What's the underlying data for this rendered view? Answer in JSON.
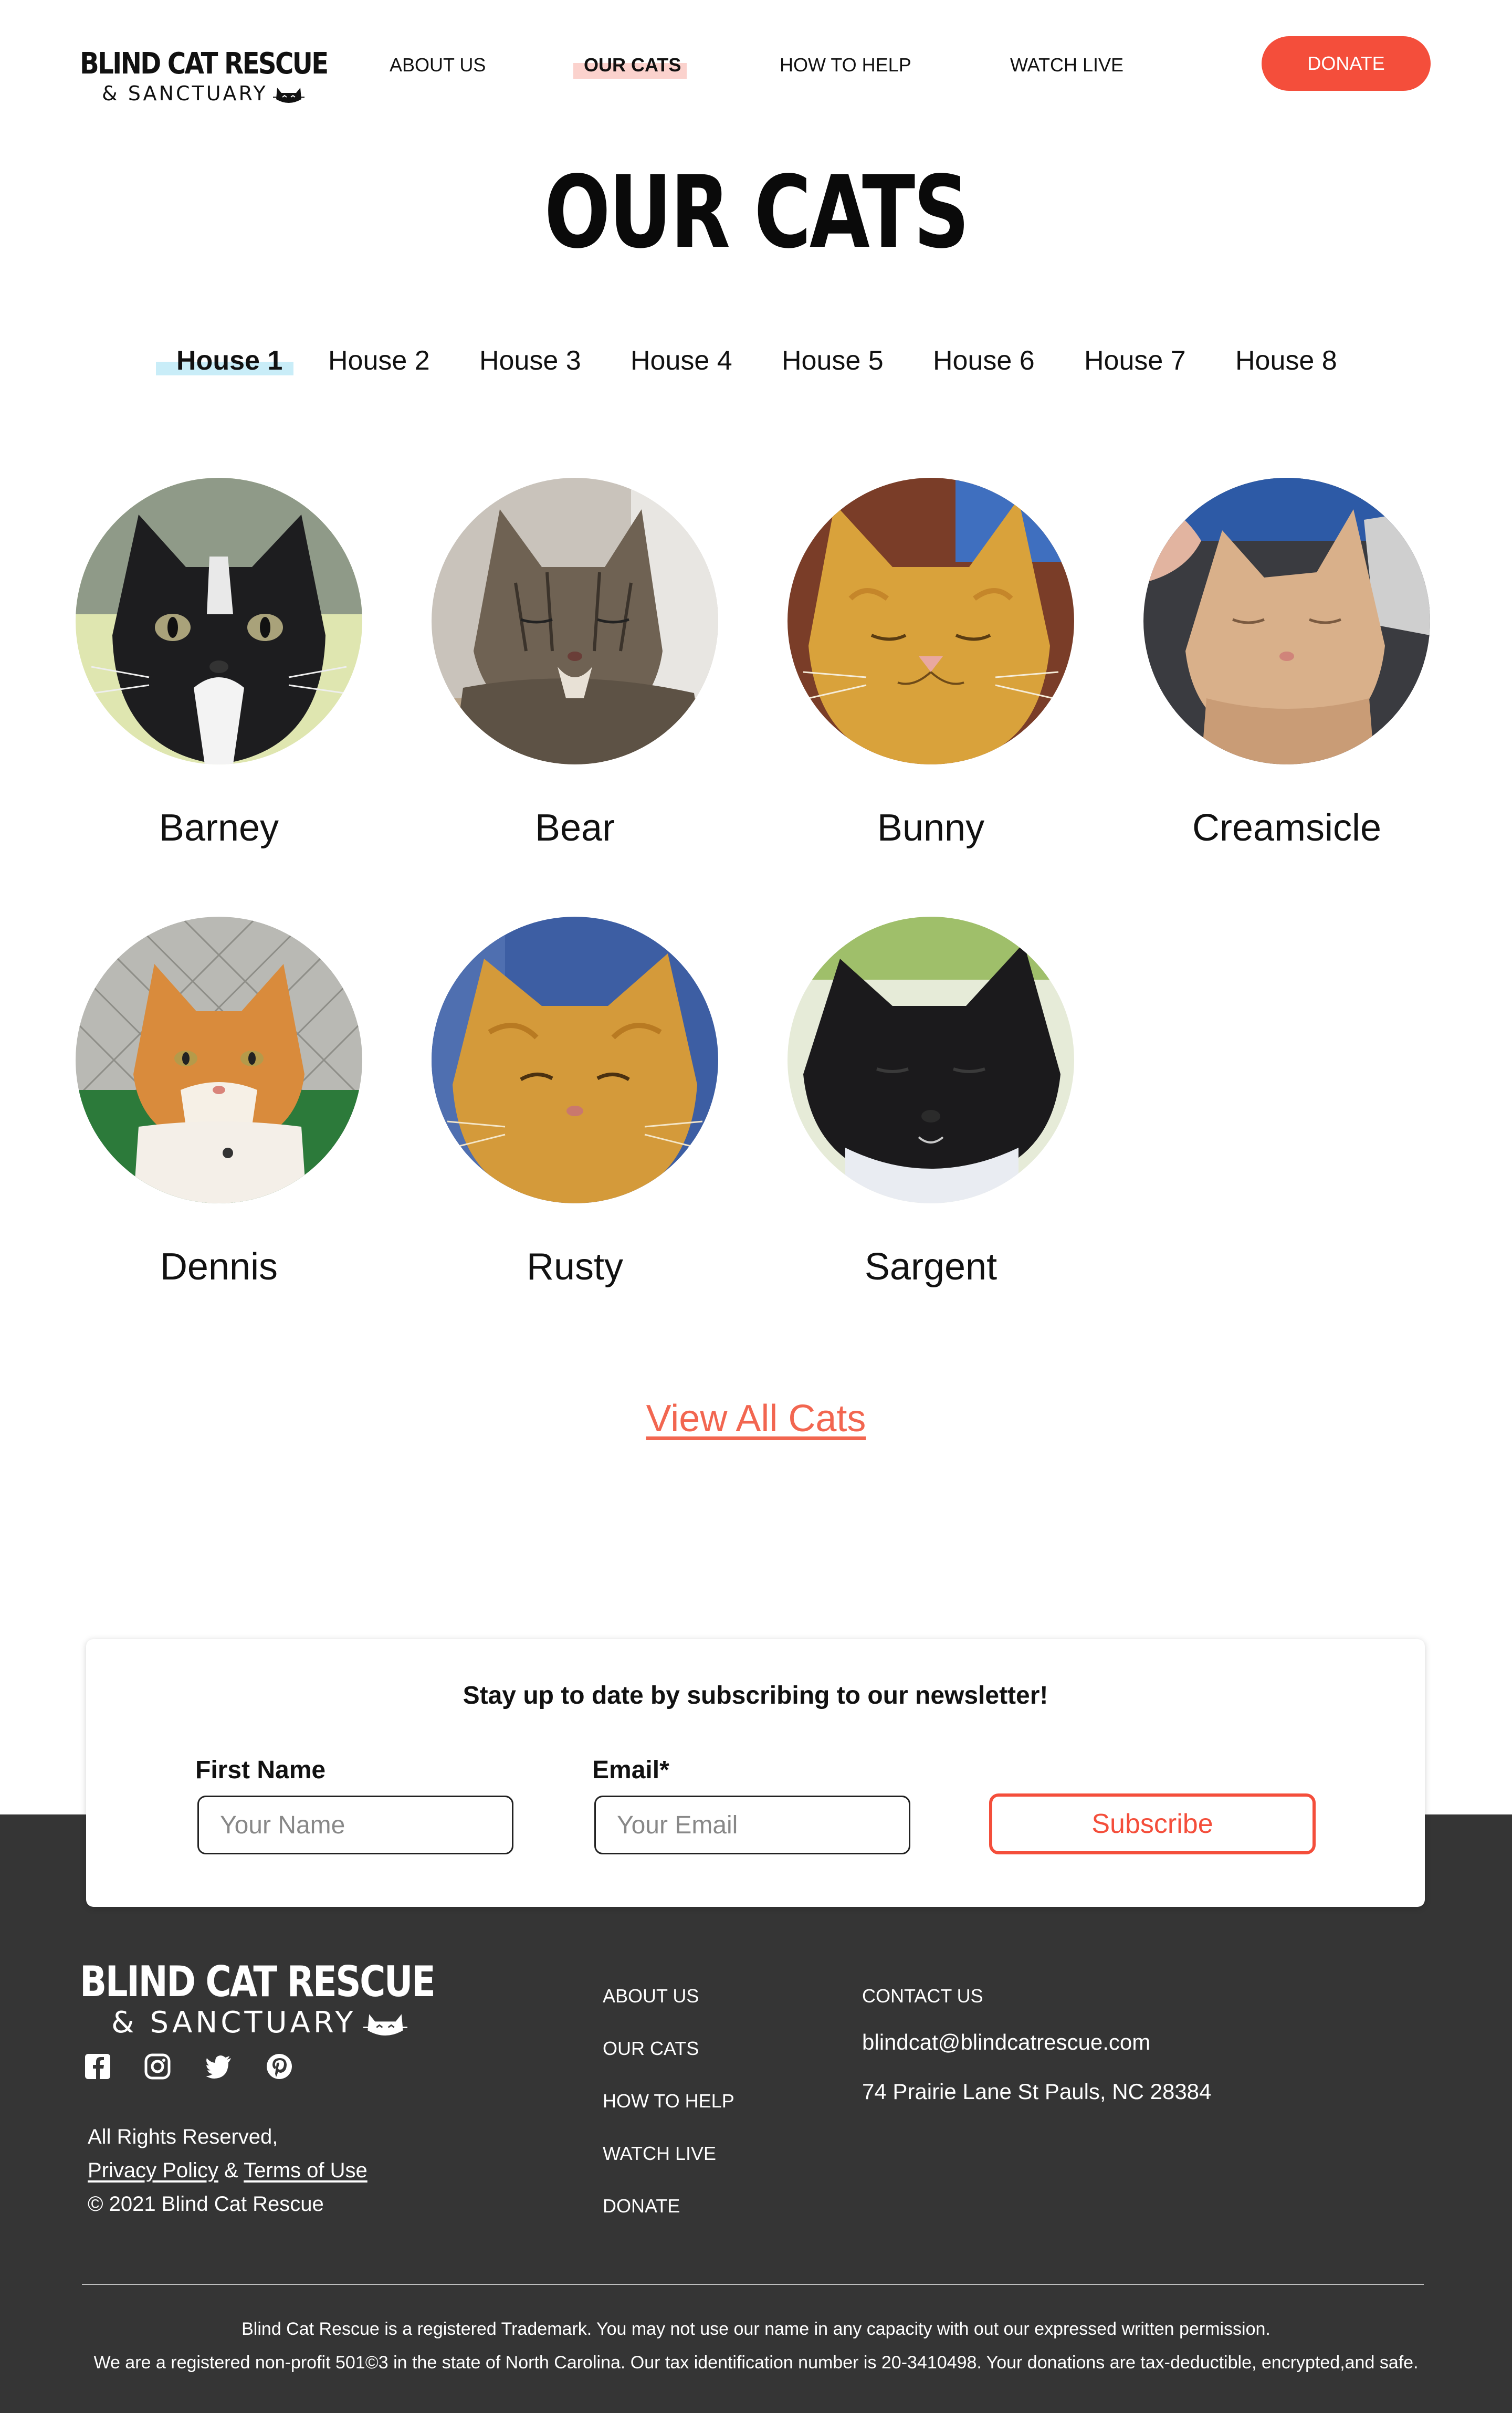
{
  "brand": {
    "name": "BLIND CAT RESCUE",
    "tagline": "& SANCTUARY"
  },
  "nav": {
    "items": [
      {
        "label": "ABOUT US",
        "active": false
      },
      {
        "label": "OUR CATS",
        "active": true
      },
      {
        "label": "HOW TO HELP",
        "active": false
      },
      {
        "label": "WATCH LIVE",
        "active": false
      }
    ],
    "donate_label": "DONATE"
  },
  "page": {
    "title": "OUR CATS"
  },
  "houses": {
    "tabs": [
      "House 1",
      "House 2",
      "House 3",
      "House 4",
      "House 5",
      "House 6",
      "House 7",
      "House 8"
    ],
    "active_index": 0
  },
  "cats": [
    {
      "name": "Barney",
      "fur": "black-white"
    },
    {
      "name": "Bear",
      "fur": "tabby"
    },
    {
      "name": "Bunny",
      "fur": "orange"
    },
    {
      "name": "Creamsicle",
      "fur": "cream"
    },
    {
      "name": "Dennis",
      "fur": "orange-white"
    },
    {
      "name": "Rusty",
      "fur": "orange"
    },
    {
      "name": "Sargent",
      "fur": "black"
    }
  ],
  "view_all_label": "View All Cats",
  "newsletter": {
    "title": "Stay up to date by subscribing to our newsletter!",
    "first_name_label": "First Name",
    "first_name_placeholder": "Your Name",
    "email_label": "Email*",
    "email_placeholder": "Your Email",
    "subscribe_label": "Subscribe"
  },
  "footer": {
    "social_icons": [
      "facebook-icon",
      "instagram-icon",
      "twitter-icon",
      "pinterest-icon"
    ],
    "rights": "All Rights Reserved,",
    "privacy_label": "Privacy Policy",
    "amp": "&",
    "terms_label": "Terms of Use",
    "copyright": "© 2021 Blind Cat Rescue",
    "nav": [
      "ABOUT US",
      "OUR CATS",
      "HOW TO HELP",
      "WATCH LIVE",
      "DONATE"
    ],
    "contact_heading": "CONTACT US",
    "email": "blindcat@blindcatrescue.com",
    "address": "74 Prairie Lane St Pauls, NC 28384",
    "legal_line_1": "Blind Cat Rescue is a registered Trademark. You may not use our name in any capacity with out our expressed written permission.",
    "legal_line_2": "We are a registered non-profit 501©3 in the state of North Carolina.  Our tax identification number is 20-3410498.  Your donations are tax-deductible, encrypted,and safe."
  },
  "colors": {
    "accent": "#f44e3b",
    "link": "#f26650",
    "nav_highlight": "#fbd2cd",
    "tab_highlight": "#c9edf8",
    "footer_bg": "#353535"
  }
}
